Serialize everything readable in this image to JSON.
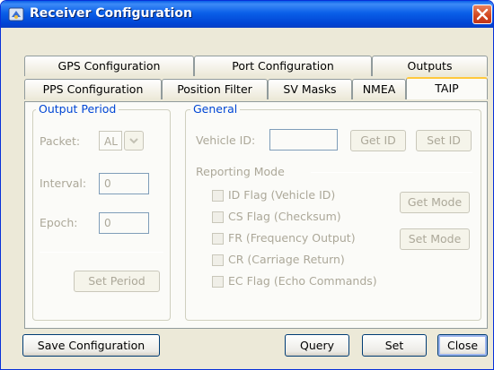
{
  "window": {
    "title": "Receiver Configuration",
    "close_glyph": "×"
  },
  "tabs_row1": [
    "GPS Configuration",
    "Port Configuration",
    "Outputs"
  ],
  "tabs_row2": [
    "PPS Configuration",
    "Position Filter",
    "SV Masks",
    "NMEA",
    "TAIP"
  ],
  "active_tab": "TAIP",
  "output_period": {
    "legend": "Output Period",
    "packet_label": "Packet:",
    "packet_value": "AL",
    "interval_label": "Interval:",
    "interval_value": "0",
    "epoch_label": "Epoch:",
    "epoch_value": "0",
    "set_period": "Set Period"
  },
  "general": {
    "legend": "General",
    "vehicle_id_label": "Vehicle ID:",
    "vehicle_id_value": "",
    "get_id": "Get ID",
    "set_id": "Set ID",
    "reporting_mode": "Reporting Mode",
    "flags": [
      "ID Flag (Vehicle ID)",
      "CS Flag (Checksum)",
      "FR (Frequency Output)",
      "CR (Carriage Return)",
      "EC Flag (Echo Commands)"
    ],
    "get_mode": "Get Mode",
    "set_mode": "Set Mode"
  },
  "footer": {
    "save": "Save Configuration",
    "query": "Query",
    "set": "Set",
    "close": "Close"
  },
  "colors": {
    "title_blue": "#0a5fe8",
    "legend_blue": "#0046d5",
    "disabled_text": "#aca899"
  }
}
